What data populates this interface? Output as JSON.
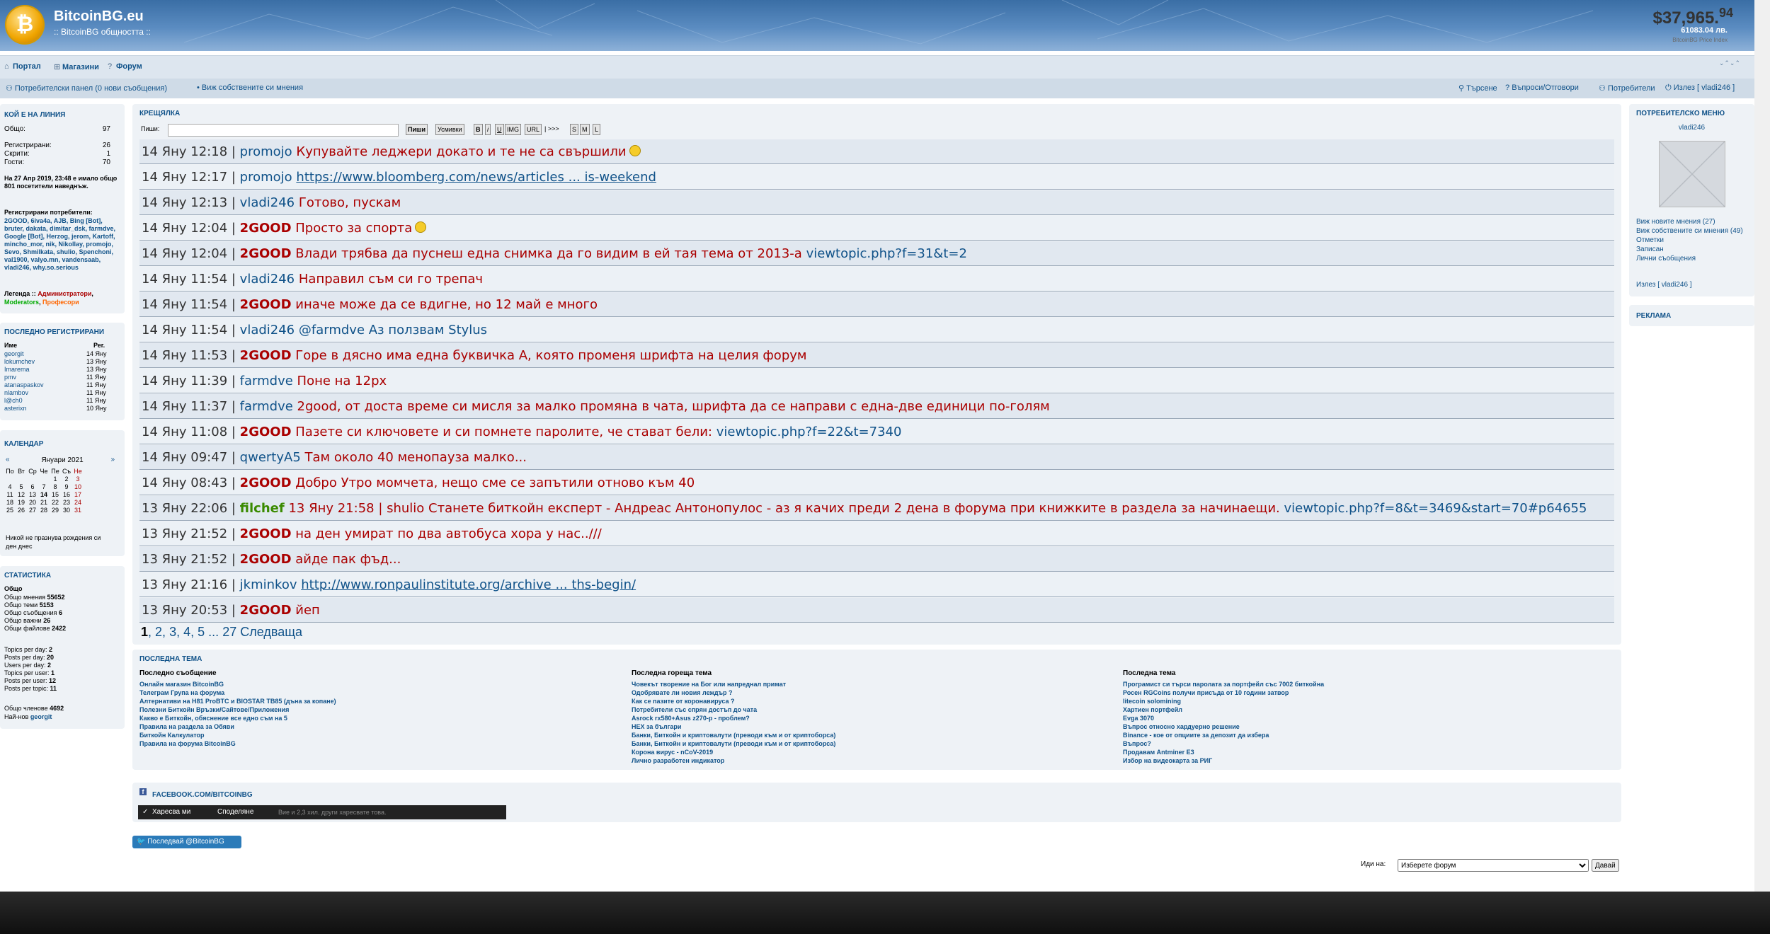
{
  "header": {
    "site_title": "BitcoinBG.eu",
    "site_subtitle": ":: BitcoinBG общността ::",
    "price_usd_main": "$37,965.",
    "price_usd_cents": "94",
    "price_bgn": "61083.04 лв.",
    "price_index": "BitcoinBG Price Index"
  },
  "nav": {
    "portal": "Портал",
    "shops": "Магазини",
    "forum": "Форум"
  },
  "nav2": {
    "user_panel": "Потребителски панел (0 нови съобщения)",
    "own_posts": "• Виж собствените си мнения",
    "search": "Търсене",
    "faq": "Въпроси/Отговори",
    "users": "Потребители",
    "logout": "Излез [ vladi246 ]"
  },
  "online": {
    "title": "КОЙ Е НА ЛИНИЯ",
    "total_label": "Общо:",
    "total": "97",
    "registered_label": "Регистрирани:",
    "registered": "26",
    "hidden_label": "Скрити:",
    "hidden": "1",
    "guests_label": "Гости:",
    "guests": "70",
    "record": "На 27 Апр 2019, 23:48 е имало общо 801 посетители наведнъж.",
    "reg_users_title": "Регистрирани потребители:",
    "reg_users": "2GOOD, 6iva4a, AJB, Bing [Bot], bruter, dakata, dimitar_dsk, farmdve, Google [Bot], Herzog, jerom, Kartoff, mincho_mor, nik, Nikollay, promojo, Sevo, Shmilkata, shulio, Spenchoni, val1900, valyo.mn, vandensaab, vladi246, why.so.serious",
    "legend_label": "Легенда ::",
    "legend_admin": "Администратори",
    "legend_mod": "Moderators",
    "legend_prof": "Професори"
  },
  "latest_registered": {
    "title": "ПОСЛЕДНО РЕГИСТРИРАНИ",
    "col_name": "Име",
    "col_reg": "Рег.",
    "rows": [
      {
        "name": "georgit",
        "date": "14 Яну"
      },
      {
        "name": "lokumchev",
        "date": "13 Яну"
      },
      {
        "name": "Imarema",
        "date": "13 Яну"
      },
      {
        "name": "pmv",
        "date": "11 Яну"
      },
      {
        "name": "atanaspaskov",
        "date": "11 Яну"
      },
      {
        "name": "nlambov",
        "date": "11 Яну"
      },
      {
        "name": "l@ch0",
        "date": "11 Яну"
      },
      {
        "name": "asterixn",
        "date": "10 Яну"
      }
    ]
  },
  "calendar": {
    "title": "КАЛЕНДАР",
    "month": "Януари 2021",
    "days": [
      "По",
      "Вт",
      "Ср",
      "Че",
      "Пе",
      "Съ",
      "Не"
    ],
    "weeks": [
      [
        "",
        "",
        "",
        "",
        "1",
        "2",
        "3"
      ],
      [
        "4",
        "5",
        "6",
        "7",
        "8",
        "9",
        "10"
      ],
      [
        "11",
        "12",
        "13",
        "14",
        "15",
        "16",
        "17"
      ],
      [
        "18",
        "19",
        "20",
        "21",
        "22",
        "23",
        "24"
      ],
      [
        "25",
        "26",
        "27",
        "28",
        "29",
        "30",
        "31"
      ]
    ],
    "birthdays": "Никой не празнува рождения си ден днес"
  },
  "stats": {
    "title": "СТАТИСТИКА",
    "total_label": "Общо",
    "lines": [
      {
        "label": "Общо мнения",
        "value": "55652"
      },
      {
        "label": "Общо теми",
        "value": "5153"
      },
      {
        "label": "Общо съобщения",
        "value": "6"
      },
      {
        "label": "Общо важни",
        "value": "26"
      },
      {
        "label": "Общи файлове",
        "value": "2422"
      }
    ],
    "lines2": [
      {
        "label": "Topics per day:",
        "value": "2"
      },
      {
        "label": "Posts per day:",
        "value": "20"
      },
      {
        "label": "Users per day:",
        "value": "2"
      },
      {
        "label": "Topics per user:",
        "value": "1"
      },
      {
        "label": "Posts per user:",
        "value": "12"
      },
      {
        "label": "Posts per topic:",
        "value": "11"
      }
    ],
    "members_label": "Общо членове",
    "members": "4692",
    "newest_label": "Най-нов",
    "newest": "georgit"
  },
  "shoutbox": {
    "title": "КРЕЩЯЛКА",
    "write_label": "Пиши:",
    "send_btn": "Пиши",
    "smilies_btn": "Усмивки",
    "fmt": [
      "B",
      "i",
      "U",
      "IMG",
      "URL"
    ],
    "arrows": "| >>>",
    "sizes": [
      "S",
      "M",
      "L"
    ],
    "messages": [
      {
        "time": "14 Яну 12:18",
        "user": "promojo",
        "urole": "user",
        "text": "Купувайте леджери докато и те не са свършили",
        "trole": "admin",
        "smiley": true
      },
      {
        "time": "14 Яну 12:17",
        "user": "promojo",
        "urole": "user",
        "text": "https://www.bloomberg.com/news/articles ... is-weekend",
        "trole": "ulink",
        "smiley": false
      },
      {
        "time": "14 Яну 12:13",
        "user": "vladi246",
        "urole": "user",
        "text": "Готово, пускам",
        "trole": "admin",
        "smiley": false
      },
      {
        "time": "14 Яну 12:04",
        "user": "2GOOD",
        "urole": "admin",
        "text": "Просто за спорта",
        "trole": "admin",
        "smiley": true
      },
      {
        "time": "14 Яну 12:04",
        "user": "2GOOD",
        "urole": "admin",
        "text": "Влади трябва да пуснеш една снимка да го видим в ей тая тема от 2013-а",
        "link": "viewtopic.php?f=31&t=2",
        "trole": "admin",
        "smiley": false
      },
      {
        "time": "14 Яну 11:54",
        "user": "vladi246",
        "urole": "user",
        "text": "Направил съм си го трепач",
        "trole": "admin",
        "smiley": false
      },
      {
        "time": "14 Яну 11:54",
        "user": "2GOOD",
        "urole": "admin",
        "text": "иначе може да се вдигне, но 12 май е много",
        "trole": "admin",
        "smiley": false
      },
      {
        "time": "14 Яну 11:54",
        "user": "vladi246",
        "urole": "user",
        "text": "@farmdve Аз ползвам Stylus",
        "trole": "user",
        "smiley": false
      },
      {
        "time": "14 Яну 11:53",
        "user": "2GOOD",
        "urole": "admin",
        "text": "Горе в дясно има една буквичка А, която променя шрифта на целия форум",
        "trole": "admin",
        "smiley": false
      },
      {
        "time": "14 Яну 11:39",
        "user": "farmdve",
        "urole": "user",
        "text": "Поне на 12px",
        "trole": "admin",
        "smiley": false
      },
      {
        "time": "14 Яну 11:37",
        "user": "farmdve",
        "urole": "user",
        "text": "2good, от доста време си мисля за малко промяна в чата, шрифта да се направи с една-две единици по-голям",
        "trole": "admin",
        "smiley": false
      },
      {
        "time": "14 Яну 11:08",
        "user": "2GOOD",
        "urole": "admin",
        "text": "Пазете си ключовете и си помнете паролите, че стават бели:",
        "link": "viewtopic.php?f=22&t=7340",
        "trole": "admin",
        "smiley": false
      },
      {
        "time": "14 Яну 09:47",
        "user": "qwertyA5",
        "urole": "user",
        "text": "Там около 40 менопауза малко...",
        "trole": "admin",
        "smiley": false
      },
      {
        "time": "14 Яну 08:43",
        "user": "2GOOD",
        "urole": "admin",
        "text": "Добро Утро момчета, нещо сме се запътили отново към 40",
        "trole": "admin",
        "smiley": false
      },
      {
        "time": "13 Яну 22:06",
        "user": "filchef",
        "urole": "green",
        "text": "13 Яну 21:58 | shulio Станете биткойн експерт - Андреас Антонопулос - аз я качих преди 2 дена в форума при книжките в раздела за начинаещи.",
        "link": "viewtopic.php?f=8&t=3469&start=70#p64655",
        "trole": "admin",
        "smiley": false
      },
      {
        "time": "13 Яну 21:52",
        "user": "2GOOD",
        "urole": "admin",
        "text": "на ден умират по два автобуса хора у нас..///",
        "trole": "admin",
        "smiley": false
      },
      {
        "time": "13 Яну 21:52",
        "user": "2GOOD",
        "urole": "admin",
        "text": "айде пак фъд...",
        "trole": "admin",
        "smiley": false
      },
      {
        "time": "13 Яну 21:16",
        "user": "jkminkov",
        "urole": "user",
        "text": "http://www.ronpaulinstitute.org/archive ... ths-begin/",
        "trole": "ulink",
        "smiley": false
      },
      {
        "time": "13 Яну 20:53",
        "user": "2GOOD",
        "urole": "admin",
        "text": "йеп",
        "trole": "admin",
        "smiley": false
      }
    ],
    "pager": {
      "current": "1",
      "pages": [
        "2",
        "3",
        "4",
        "5"
      ],
      "ellipsis": "...",
      "last": "27",
      "next": "Следваща"
    }
  },
  "latest": {
    "title": "ПОСЛЕДНА ТЕМА",
    "col1_title": "Последно съобщение",
    "col1": [
      "Онлайн магазин BitcoinBG",
      "Телеграм Група на форума",
      "Алтернативи на H81 ProBTC и BIOSTAR TB85 (дъна за копане)",
      "Полезни Биткойн Връзки/Сайтове/Приложения",
      "Какво е Биткойн, обяснение все едно съм на 5",
      "Правила на раздела за Обяви",
      "Биткойн Калкулатор",
      "Правила на форума BitcoinBG"
    ],
    "col2_title": "Последна гореща тема",
    "col2": [
      "Човекът творение на Бог или напреднал примат",
      "Одобрявате ли новия леждър ?",
      "Как се пазите от коронавируса ?",
      "Потребители със спрян достъп до чата",
      "Asrock rx580+Asus z270-p - проблем?",
      "HEX за българи",
      "Банки, Биткойн и криптовалути (преводи към и от криптоборса)",
      "Банки, Биткойн и криптовалути (преводи към и от криптоборса)",
      "Корона вирус - nCoV-2019",
      "Лично разработен индикатор"
    ],
    "col3_title": "Последна тема",
    "col3": [
      "Програмист си търси паролата за портфейл със 7002 биткойна",
      "Росен RGCoins получи присъда от 10 години затвор",
      "litecoin solomining",
      "Хартиен портфейл",
      "Evga 3070",
      "Въпрос относно хардуерно решение",
      "Binance - кое от опциите за депозит да избера",
      "Въпрос?",
      "Продавам Antminer E3",
      "Избор на видеокарта за РИГ"
    ]
  },
  "facebook": {
    "title": "FACEBOOK.COM/BITCOINBG",
    "like": "Харесва ми",
    "share": "Споделяне",
    "count_text": "Вие и 2,3 хил. други харесвате това."
  },
  "twitter": {
    "label": "Последвай @BitcoinBG"
  },
  "user_menu": {
    "title": "ПОТРЕБИТЕЛСКО МЕНЮ",
    "username": "vladi246",
    "links": [
      "Виж новите мнения (27)",
      "Виж собствените си мнения (49)",
      "Отметки",
      "Записан",
      "Лични съобщения"
    ],
    "logout": "Излез [ vladi246 ]"
  },
  "ads": {
    "title": "РЕКЛАМА"
  },
  "jump": {
    "label": "Иди на:",
    "select": "Изберете форум",
    "go": "Давай"
  },
  "colors": {
    "admin": "#aa0000",
    "user": "#105289",
    "green": "#3a8a00",
    "header": "#3a6ea5"
  }
}
